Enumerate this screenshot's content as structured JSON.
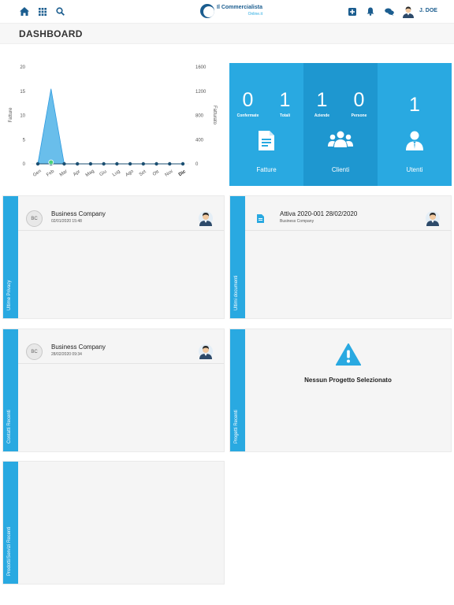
{
  "topbar": {
    "icons": [
      "home-icon",
      "grid-icon",
      "search-icon",
      "plus-square-icon",
      "bell-icon",
      "chat-icon"
    ],
    "logo_line1": "Il Commercialista",
    "logo_line2": "Online.it",
    "user_name": "J. DOE"
  },
  "header": {
    "title": "DASHBOARD"
  },
  "chart_data": {
    "type": "area",
    "categories": [
      "Gen",
      "Feb",
      "Mar",
      "Apr",
      "Mag",
      "Giu",
      "Lug",
      "Ago",
      "Set",
      "Ott",
      "Nov",
      "Dic"
    ],
    "series": [
      {
        "name": "Fatture",
        "axis": "left",
        "values": [
          0,
          15.5,
          0,
          0,
          0,
          0,
          0,
          0,
          0,
          0,
          0,
          0
        ],
        "color": "#4fb3e8"
      },
      {
        "name": "Fatturato",
        "axis": "right",
        "values": [
          0,
          0,
          0,
          0,
          0,
          0,
          0,
          0,
          0,
          0,
          0,
          0
        ],
        "color": "#1b4f72"
      }
    ],
    "ylabel": "Fatture",
    "y2label": "Fatturato",
    "ylim": [
      0,
      20
    ],
    "yticks": [
      "20",
      "15",
      "10",
      "5",
      "0"
    ],
    "y2lim": [
      0,
      1600
    ],
    "y2ticks": [
      "1600",
      "1200",
      "800",
      "400",
      "0"
    ],
    "grid": false
  },
  "stats": {
    "fatture": {
      "confermate": "0",
      "confermate_label": "Confermate",
      "totali": "1",
      "totali_label": "Totali",
      "label": "Fatture"
    },
    "clienti": {
      "aziende": "1",
      "aziende_label": "Aziende",
      "persone": "0",
      "persone_label": "Persone",
      "label": "Clienti"
    },
    "utenti": {
      "count": "1",
      "label": "Utenti"
    }
  },
  "panels": {
    "privacy": {
      "side_label": "Ultime Privacy",
      "avatar": "BC",
      "title": "Business Company",
      "sub": "02/01/2020 15:48"
    },
    "documenti": {
      "side_label": "Ultimi documenti",
      "title": "Attiva 2020-001 28/02/2020",
      "sub": "Business Company"
    },
    "contatti": {
      "side_label": "Contatti Recenti",
      "avatar": "BC",
      "title": "Business Company",
      "sub": "28/02/2020 09:34"
    },
    "progetti": {
      "side_label": "Progetti Recenti",
      "message": "Nessun Progetto Selezionato"
    },
    "prodotti": {
      "side_label": "Prodotti/Servizi Recenti"
    }
  },
  "colors": {
    "accent": "#29a9e1",
    "accent_dark": "#1e97d0",
    "brand": "#1b5d8f",
    "warning": "#29a9e1"
  }
}
